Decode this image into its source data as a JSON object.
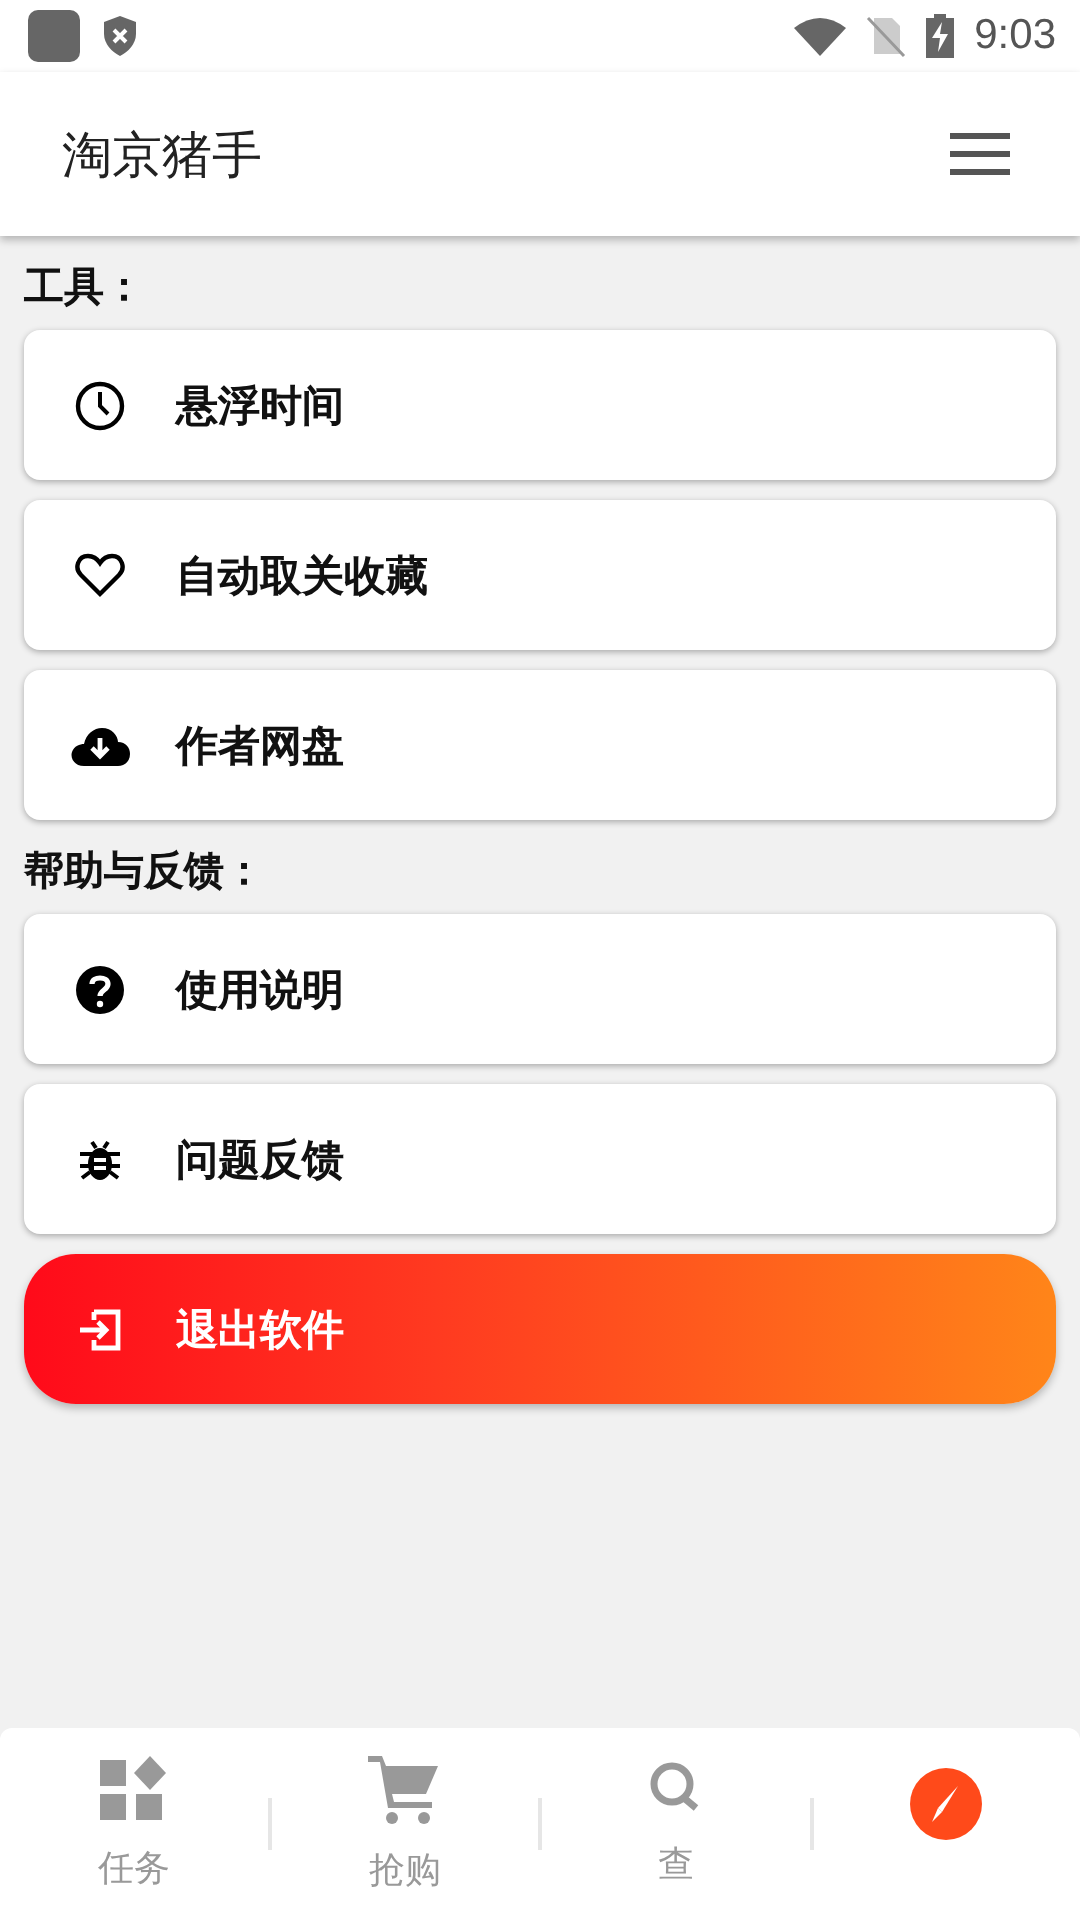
{
  "status_bar": {
    "time": "9:03"
  },
  "app_bar": {
    "title": "淘京猪手"
  },
  "sections": [
    {
      "title": "工具：",
      "items": [
        {
          "kind": "clock",
          "label": "悬浮时间"
        },
        {
          "kind": "heart",
          "label": "自动取关收藏"
        },
        {
          "kind": "cloud",
          "label": "作者网盘"
        }
      ]
    },
    {
      "title": "帮助与反馈：",
      "items": [
        {
          "kind": "help",
          "label": "使用说明"
        },
        {
          "kind": "bug",
          "label": "问题反馈"
        }
      ]
    }
  ],
  "exit_button": {
    "label": "退出软件"
  },
  "bottom_nav": [
    {
      "kind": "grid",
      "label": "任务",
      "selected": false
    },
    {
      "kind": "cart",
      "label": "抢购",
      "selected": false
    },
    {
      "kind": "search",
      "label": "查",
      "selected": false
    },
    {
      "kind": "compass",
      "selected": true
    }
  ]
}
